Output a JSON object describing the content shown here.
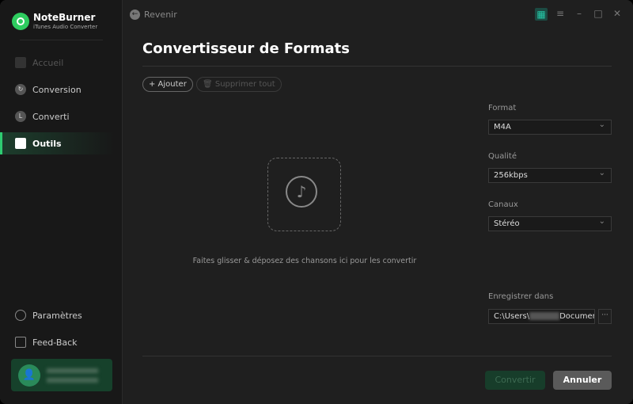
{
  "app": {
    "name": "NoteBurner",
    "subtitle": "iTunes Audio Converter",
    "accent": "#2ecc71"
  },
  "sidebar": {
    "items": [
      {
        "label": "Accueil",
        "icon": "home-icon",
        "state": "disabled"
      },
      {
        "label": "Conversion",
        "icon": "refresh-icon",
        "state": "normal"
      },
      {
        "label": "Converti",
        "icon": "clock-icon",
        "state": "normal"
      },
      {
        "label": "Outils",
        "icon": "toolbox-icon",
        "state": "active"
      }
    ],
    "bottom": [
      {
        "label": "Paramètres",
        "icon": "gear-icon"
      },
      {
        "label": "Feed-Back",
        "icon": "mail-icon"
      }
    ]
  },
  "header": {
    "back_label": "Revenir"
  },
  "main": {
    "title": "Convertisseur de Formats",
    "add_label": "+ Ajouter",
    "delete_label": "Supprimer tout",
    "drop_hint": "Faites glisser & déposez des chansons ici pour les convertir"
  },
  "settings": {
    "format_label": "Format",
    "format_value": "M4A",
    "quality_label": "Qualité",
    "quality_value": "256kbps",
    "channels_label": "Canaux",
    "channels_value": "Stéréo",
    "save_label": "Enregistrer dans",
    "path_prefix": "C:\\Users\\",
    "path_suffix": "Documen",
    "browse": "···"
  },
  "footer": {
    "convert_label": "Convertir",
    "cancel_label": "Annuler"
  }
}
